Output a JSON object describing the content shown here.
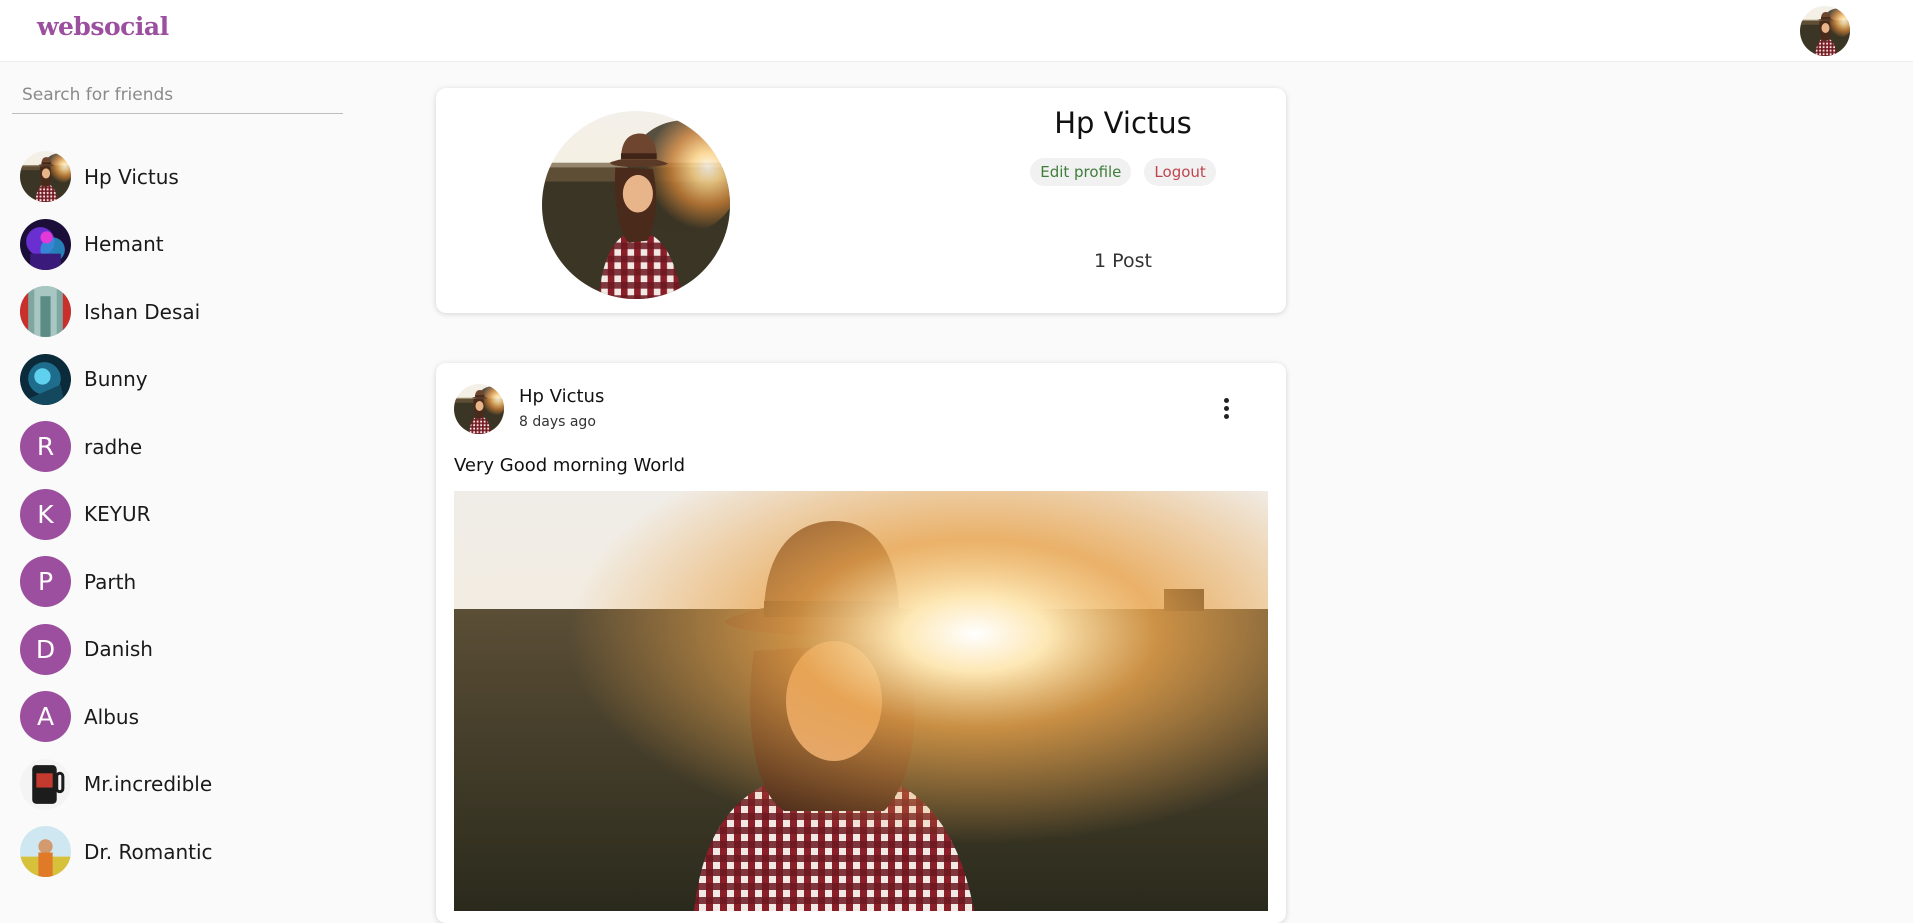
{
  "app": {
    "logo": "websocial"
  },
  "sidebar": {
    "search_placeholder": "Search for friends",
    "friends": [
      {
        "name": "Hp Victus",
        "avatar": "photo-sunset-woman"
      },
      {
        "name": "Hemant",
        "avatar": "photo-neon"
      },
      {
        "name": "Ishan Desai",
        "avatar": "photo-corridor"
      },
      {
        "name": "Bunny",
        "avatar": "photo-blue-fantasy"
      },
      {
        "name": "radhe",
        "letter": "R"
      },
      {
        "name": "KEYUR",
        "letter": "K"
      },
      {
        "name": "Parth",
        "letter": "P"
      },
      {
        "name": "Danish",
        "letter": "D"
      },
      {
        "name": "Albus",
        "letter": "A"
      },
      {
        "name": "Mr.incredible",
        "avatar": "photo-mug"
      },
      {
        "name": "Dr. Romantic",
        "avatar": "photo-flowers"
      }
    ]
  },
  "profile": {
    "name": "Hp Victus",
    "edit_label": "Edit profile",
    "logout_label": "Logout",
    "post_count": "1 Post"
  },
  "post": {
    "author": "Hp Victus",
    "time": "8 days ago",
    "text": "Very Good morning World",
    "menu_icon": "more-vertical-icon"
  },
  "colors": {
    "brand": "#9b4f9e",
    "edit": "#3f7d3a",
    "logout": "#c0444f"
  }
}
